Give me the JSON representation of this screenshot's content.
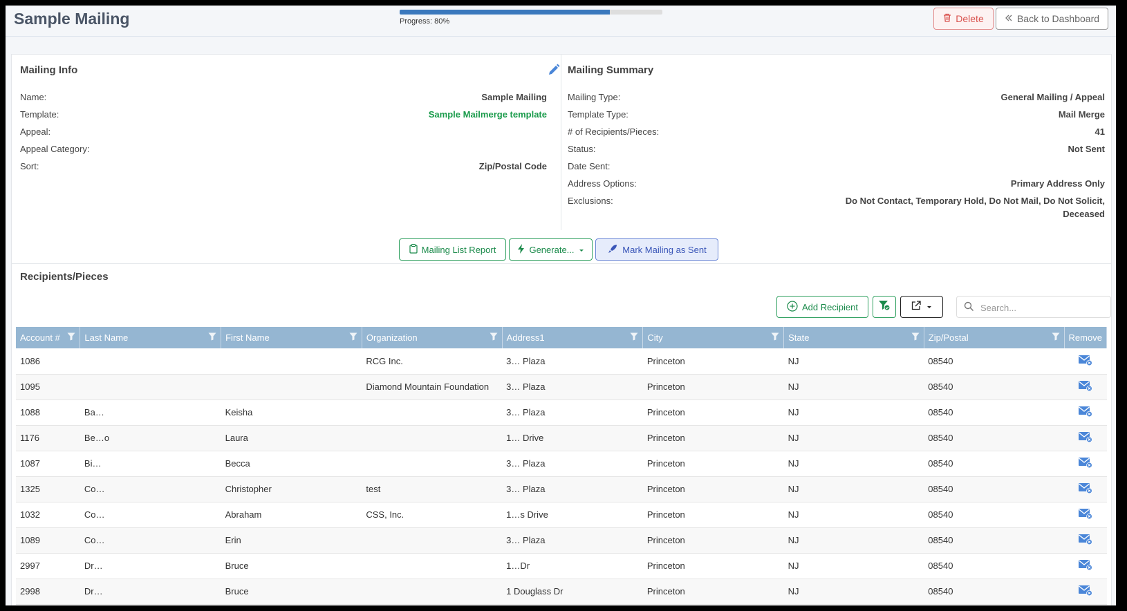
{
  "header": {
    "title": "Sample Mailing",
    "progress_text": "Progress: 80%",
    "progress_value": 0.8,
    "delete_label": "Delete",
    "back_label": "Back to Dashboard"
  },
  "mailing_info": {
    "title": "Mailing Info",
    "rows": [
      {
        "label": "Name:",
        "value": "Sample Mailing"
      },
      {
        "label": "Template:",
        "value": "Sample Mailmerge template"
      },
      {
        "label": "Appeal:",
        "value": ""
      },
      {
        "label": "Appeal Category:",
        "value": ""
      },
      {
        "label": "Sort:",
        "value": "Zip/Postal Code"
      }
    ]
  },
  "mailing_summary": {
    "title": "Mailing Summary",
    "rows": [
      {
        "label": "Mailing Type:",
        "value": "General Mailing / Appeal"
      },
      {
        "label": "Template Type:",
        "value": "Mail Merge"
      },
      {
        "label": "# of Recipients/Pieces:",
        "value": "41"
      },
      {
        "label": "Status:",
        "value": "Not Sent"
      },
      {
        "label": "Date Sent:",
        "value": ""
      },
      {
        "label": "Address Options:",
        "value": "Primary Address Only"
      },
      {
        "label": "Exclusions:",
        "value": "Do Not Contact, Temporary Hold, Do Not Mail, Do Not Solicit,"
      },
      {
        "label": "",
        "value": "Deceased"
      }
    ]
  },
  "actions": {
    "mailing_list_report": "Mailing List Report",
    "generate": "Generate...",
    "mark_sent": "Mark Mailing as Sent"
  },
  "recipients": {
    "title": "Recipients/Pieces",
    "add_label": "Add Recipient",
    "search_placeholder": "Search...",
    "columns": [
      "Account #",
      "Last Name",
      "First Name",
      "Organization",
      "Address1",
      "City",
      "State",
      "Zip/Postal",
      "Remove"
    ],
    "rows": [
      [
        "1086",
        "",
        "",
        "RCG Inc.",
        "3… Plaza",
        "Princeton",
        "NJ",
        "08540"
      ],
      [
        "1095",
        "",
        "",
        "Diamond Mountain Foundation",
        "3… Plaza",
        "Princeton",
        "NJ",
        "08540"
      ],
      [
        "1088",
        "Ba…",
        "Keisha",
        "",
        "3… Plaza",
        "Princeton",
        "NJ",
        "08540"
      ],
      [
        "1176",
        "Be…o",
        "Laura",
        "",
        "1… Drive",
        "Princeton",
        "NJ",
        "08540"
      ],
      [
        "1087",
        "Bi…",
        "Becca",
        "",
        "3… Plaza",
        "Princeton",
        "NJ",
        "08540"
      ],
      [
        "1325",
        "Co…",
        "Christopher",
        "test",
        "3… Plaza",
        "Princeton",
        "NJ",
        "08540"
      ],
      [
        "1032",
        "Co…",
        "Abraham",
        "CSS, Inc.",
        "1…s Drive",
        "Princeton",
        "NJ",
        "08540"
      ],
      [
        "1089",
        "Co…",
        "Erin",
        "",
        "3… Plaza",
        "Princeton",
        "NJ",
        "08540"
      ],
      [
        "2997",
        "Dr…",
        "Bruce",
        "",
        "1…Dr",
        "Princeton",
        "NJ",
        "08540"
      ],
      [
        "2998",
        "Dr…",
        "Bruce",
        "",
        "1 Douglass Dr",
        "Princeton",
        "NJ",
        "08540"
      ]
    ]
  },
  "colors": {
    "accent_blue": "#3a78bd",
    "green": "#1a9b4b",
    "header_bg": "#95b6d2",
    "danger": "#d9534f"
  }
}
